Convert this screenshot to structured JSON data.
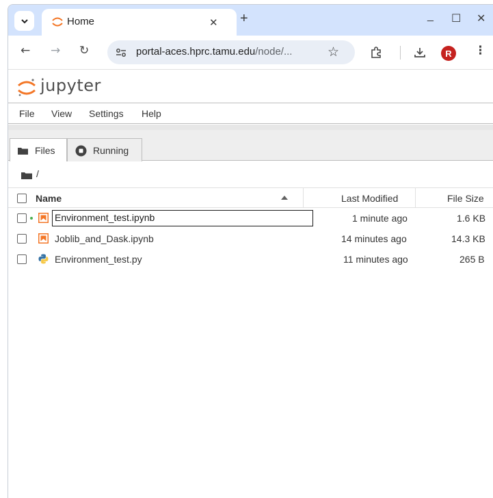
{
  "browser": {
    "tab_title": "Home",
    "tab_close": "✕",
    "new_tab": "+",
    "minimize": "_",
    "maximize": "☐",
    "close": "✕",
    "url_host": "portal-aces.hprc.tamu.edu",
    "url_path": "/node/...",
    "profile_initial": "R",
    "accent_color": "#d3e3fd"
  },
  "jupyter": {
    "brand": "jupyter",
    "menu": [
      "File",
      "View",
      "Settings",
      "Help"
    ],
    "sidebar_tabs": [
      {
        "label": "Files",
        "icon": "folder-icon",
        "active": true
      },
      {
        "label": "Running",
        "icon": "stop-circle-icon",
        "active": false
      }
    ],
    "breadcrumb": "/",
    "columns": {
      "name": "Name",
      "modified": "Last Modified",
      "size": "File Size"
    },
    "files": [
      {
        "name": "Environment_test.ipynb",
        "modified": "1 minute ago",
        "size": "1.6 KB",
        "type": "notebook",
        "renaming": true,
        "running": true
      },
      {
        "name": "Joblib_and_Dask.ipynb",
        "modified": "14 minutes ago",
        "size": "14.3 KB",
        "type": "notebook",
        "renaming": false,
        "running": false
      },
      {
        "name": "Environment_test.py",
        "modified": "11 minutes ago",
        "size": "265 B",
        "type": "python",
        "renaming": false,
        "running": false
      }
    ]
  }
}
